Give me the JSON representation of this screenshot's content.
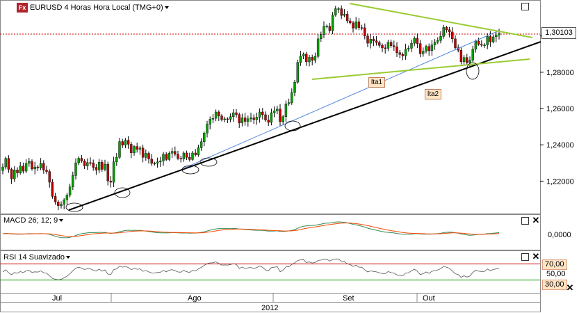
{
  "window": {
    "title": "EURUSD 4 Horas Hora Local (TMG+0)",
    "logo_text": "Fx"
  },
  "price_badge": "1,30103",
  "trendline_labels": [
    "lta1",
    "lta2"
  ],
  "macd": {
    "title": "MACD 26; 12; 9",
    "axis_label": "0,0000"
  },
  "rsi": {
    "title": "RSI 14 Suavizado",
    "upper": "70,00",
    "mid": "50,00",
    "lower": "30,00"
  },
  "colors": {
    "up_candle": "#00a000",
    "down_candle": "#c00000",
    "wick": "#000000",
    "support_line": "#000000",
    "channel": "#99cc33",
    "thin_trend": "#5588dd",
    "price_line": "#cc0000",
    "macd_line": "#2e8b57",
    "signal_line": "#ff4500",
    "rsi_line": "#555555",
    "rsi_upper": "#cc0000",
    "rsi_lower": "#009900"
  },
  "chart_data": {
    "type": "candlestick",
    "title": "EURUSD 4 Horas Hora Local (TMG+0)",
    "y_ticks": [
      "1,22000",
      "1,24000",
      "1,26000",
      "1,28000",
      "1,30000"
    ],
    "ylim": [
      1.2033,
      1.3175
    ],
    "x_ticks": [
      "Jul",
      "Ago",
      "Set",
      "Out"
    ],
    "year_label": "2012",
    "last_price": 1.30103,
    "close_series": [
      1.2278,
      1.2325,
      1.2265,
      1.2212,
      1.2262,
      1.2245,
      1.2283,
      1.2255,
      1.2298,
      1.2308,
      1.2267,
      1.2278,
      1.2273,
      1.2298,
      1.2261,
      1.2253,
      1.2194,
      1.2116,
      1.2085,
      1.2065,
      1.2073,
      1.2097,
      1.2123,
      1.2168,
      1.2231,
      1.2301,
      1.2326,
      1.2312,
      1.2284,
      1.2302,
      1.2301,
      1.2276,
      1.2261,
      1.2304,
      1.2265,
      1.2293,
      1.2201,
      1.2194,
      1.2306,
      1.2331,
      1.2418,
      1.2398,
      1.2425,
      1.2403,
      1.2356,
      1.2391,
      1.2375,
      1.2383,
      1.2331,
      1.2353,
      1.2322,
      1.2298,
      1.2298,
      1.2306,
      1.2311,
      1.2348,
      1.2319,
      1.2354,
      1.2364,
      1.2348,
      1.2325,
      1.2322,
      1.2355,
      1.2331,
      1.2319,
      1.2355,
      1.2345,
      1.2384,
      1.2417,
      1.2465,
      1.2514,
      1.2541,
      1.2546,
      1.2581,
      1.2559,
      1.2539,
      1.2543,
      1.2541,
      1.2555,
      1.2577,
      1.2567,
      1.2521,
      1.2549,
      1.2529,
      1.2543,
      1.2549,
      1.2539,
      1.2552,
      1.2581,
      1.2566,
      1.2536,
      1.2524,
      1.2577,
      1.2587,
      1.2597,
      1.2528,
      1.2555,
      1.2626,
      1.2632,
      1.2688,
      1.2745,
      1.2854,
      1.2889,
      1.29,
      1.2857,
      1.2882,
      1.2866,
      1.2887,
      1.2984,
      1.3008,
      1.3053,
      1.3053,
      1.3029,
      1.3115,
      1.315,
      1.315,
      1.3113,
      1.312,
      1.3083,
      1.3072,
      1.3043,
      1.3078,
      1.3046,
      1.3045,
      1.3,
      1.296,
      1.2982,
      1.2973,
      1.2964,
      1.2948,
      1.2934,
      1.2932,
      1.2965,
      1.2946,
      1.294,
      1.2908,
      1.2898,
      1.289,
      1.2928,
      1.2932,
      1.296,
      1.2987,
      1.2958,
      1.2902,
      1.2915,
      1.2942,
      1.2919,
      1.2951,
      1.2965,
      1.2975,
      1.2998,
      1.3047,
      1.3034,
      1.3022,
      1.2984,
      1.2935,
      1.2921,
      1.2858,
      1.2881,
      1.2852,
      1.2866,
      1.2927,
      1.2972,
      1.2954,
      1.2949,
      1.295,
      1.2997,
      1.2967,
      1.2995,
      1.3005,
      1.3013
    ]
  }
}
